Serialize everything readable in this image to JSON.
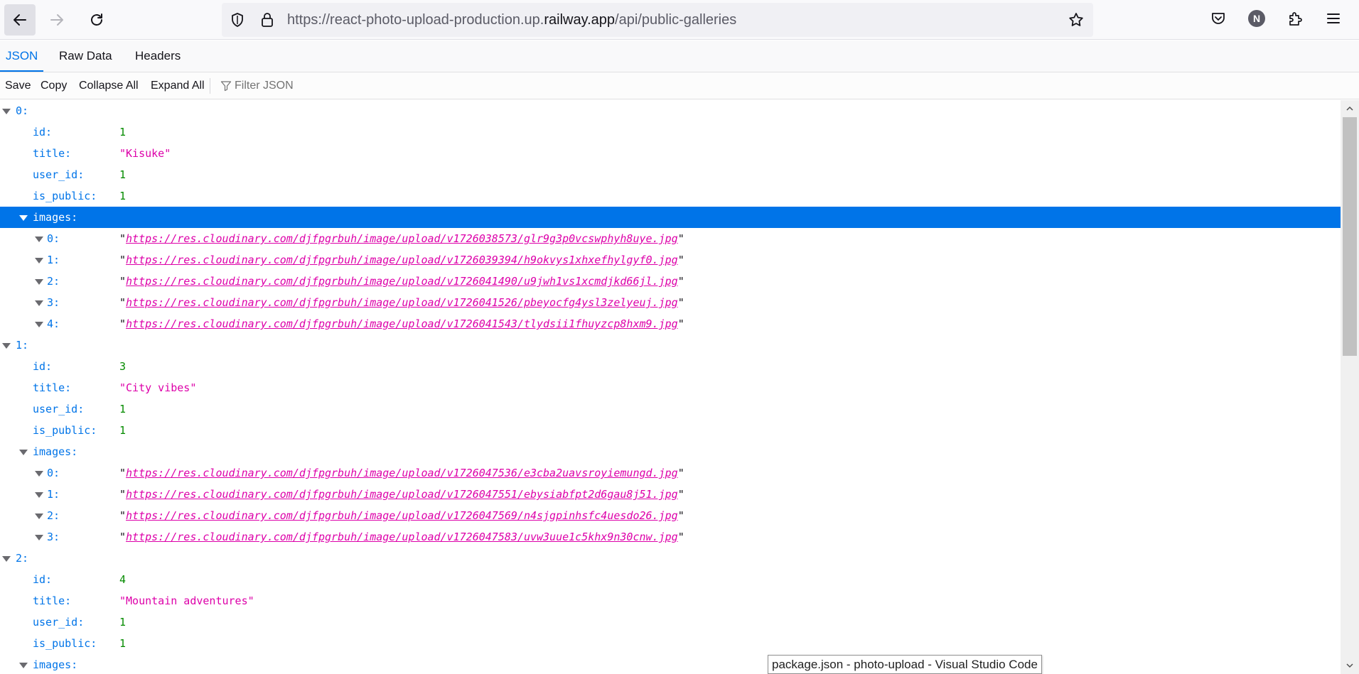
{
  "browser": {
    "url_prefix": "https://react-photo-upload-production.up.",
    "url_host": "railway.app",
    "url_path": "/api/public-galleries",
    "account_initial": "N"
  },
  "viewer": {
    "tabs": [
      {
        "label": "JSON",
        "active": true
      },
      {
        "label": "Raw Data",
        "active": false
      },
      {
        "label": "Headers",
        "active": false
      }
    ],
    "toolbar": {
      "save": "Save",
      "copy": "Copy",
      "collapse_all": "Collapse All",
      "expand_all": "Expand All",
      "filter_placeholder": "Filter JSON"
    }
  },
  "tree": [
    {
      "key": "0:",
      "level": 0,
      "twisty": true
    },
    {
      "key": "id:",
      "level": 1,
      "value": "1",
      "type": "number"
    },
    {
      "key": "title:",
      "level": 1,
      "value": "\"Kisuke\"",
      "type": "string"
    },
    {
      "key": "user_id:",
      "level": 1,
      "value": "1",
      "type": "number"
    },
    {
      "key": "is_public:",
      "level": 1,
      "value": "1",
      "type": "number"
    },
    {
      "key": "images:",
      "level": 1,
      "twisty": true,
      "selected": true
    },
    {
      "key": "0:",
      "level": 2,
      "twisty": true,
      "value": "https://res.cloudinary.com/djfpgrbuh/image/upload/v1726038573/glr9g3p0vcswphyh8uye.jpg",
      "type": "url"
    },
    {
      "key": "1:",
      "level": 2,
      "twisty": true,
      "value": "https://res.cloudinary.com/djfpgrbuh/image/upload/v1726039394/h9okvys1xhxefhylgyf0.jpg",
      "type": "url"
    },
    {
      "key": "2:",
      "level": 2,
      "twisty": true,
      "value": "https://res.cloudinary.com/djfpgrbuh/image/upload/v1726041490/u9jwh1vs1xcmdjkd66jl.jpg",
      "type": "url"
    },
    {
      "key": "3:",
      "level": 2,
      "twisty": true,
      "value": "https://res.cloudinary.com/djfpgrbuh/image/upload/v1726041526/pbeyocfg4ysl3zelyeuj.jpg",
      "type": "url"
    },
    {
      "key": "4:",
      "level": 2,
      "twisty": true,
      "value": "https://res.cloudinary.com/djfpgrbuh/image/upload/v1726041543/tlydsii1fhuyzcp8hxm9.jpg",
      "type": "url"
    },
    {
      "key": "1:",
      "level": 0,
      "twisty": true
    },
    {
      "key": "id:",
      "level": 1,
      "value": "3",
      "type": "number"
    },
    {
      "key": "title:",
      "level": 1,
      "value": "\"City vibes\"",
      "type": "string"
    },
    {
      "key": "user_id:",
      "level": 1,
      "value": "1",
      "type": "number"
    },
    {
      "key": "is_public:",
      "level": 1,
      "value": "1",
      "type": "number"
    },
    {
      "key": "images:",
      "level": 1,
      "twisty": true
    },
    {
      "key": "0:",
      "level": 2,
      "twisty": true,
      "value": "https://res.cloudinary.com/djfpgrbuh/image/upload/v1726047536/e3cba2uavsroyiemungd.jpg",
      "type": "url"
    },
    {
      "key": "1:",
      "level": 2,
      "twisty": true,
      "value": "https://res.cloudinary.com/djfpgrbuh/image/upload/v1726047551/ebysiabfpt2d6gau8j51.jpg",
      "type": "url"
    },
    {
      "key": "2:",
      "level": 2,
      "twisty": true,
      "value": "https://res.cloudinary.com/djfpgrbuh/image/upload/v1726047569/n4sjgpinhsfc4uesdo26.jpg",
      "type": "url"
    },
    {
      "key": "3:",
      "level": 2,
      "twisty": true,
      "value": "https://res.cloudinary.com/djfpgrbuh/image/upload/v1726047583/uvw3uue1c5khx9n30cnw.jpg",
      "type": "url"
    },
    {
      "key": "2:",
      "level": 0,
      "twisty": true
    },
    {
      "key": "id:",
      "level": 1,
      "value": "4",
      "type": "number"
    },
    {
      "key": "title:",
      "level": 1,
      "value": "\"Mountain adventures\"",
      "type": "string"
    },
    {
      "key": "user_id:",
      "level": 1,
      "value": "1",
      "type": "number"
    },
    {
      "key": "is_public:",
      "level": 1,
      "value": "1",
      "type": "number"
    },
    {
      "key": "images:",
      "level": 1,
      "twisty": true
    }
  ],
  "tooltip": "package.json - photo-upload - Visual Studio Code"
}
